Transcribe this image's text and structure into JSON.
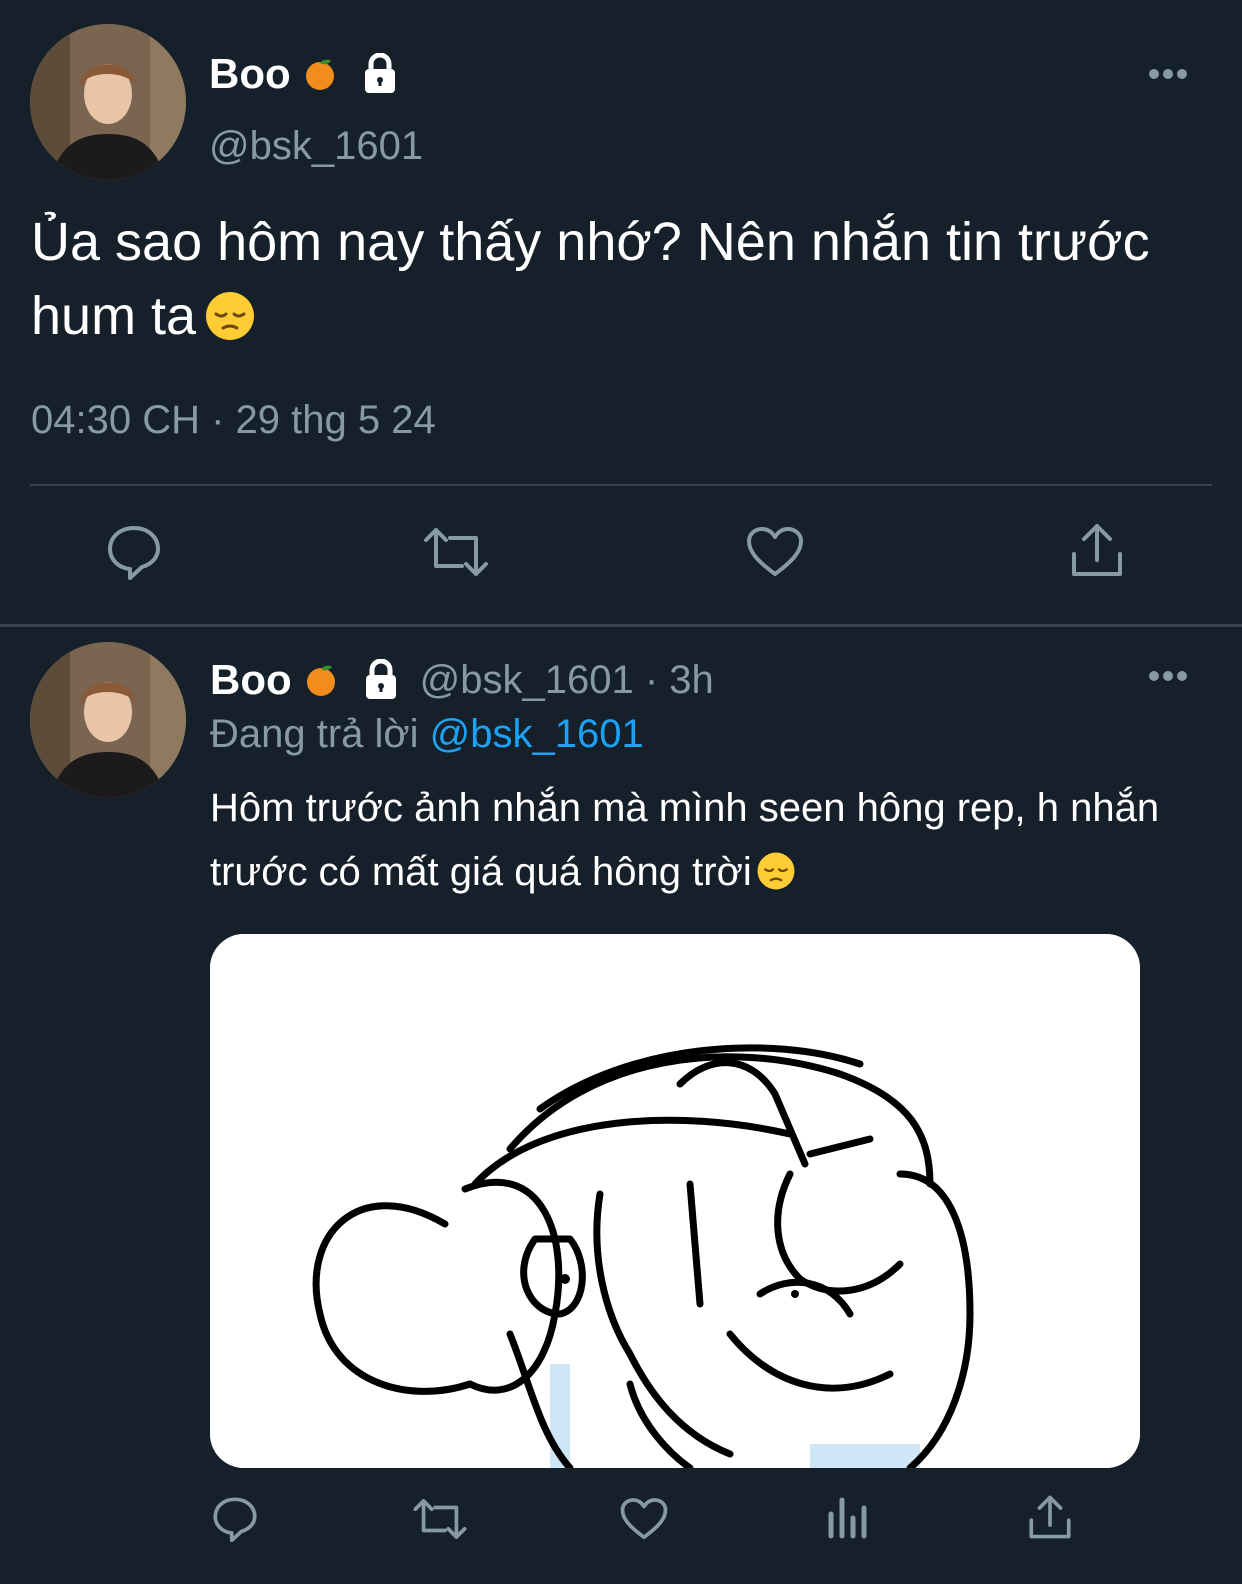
{
  "main_tweet": {
    "display_name": "Boo",
    "handle": "@bsk_1601",
    "text": "Ủa sao hôm nay thấy nhớ? Nên nhắn tin trước hum ta",
    "timestamp": "04:30 CH · 29 thg 5 24",
    "actions": [
      "reply-icon",
      "retweet-icon",
      "like-icon",
      "share-icon"
    ]
  },
  "reply_tweet": {
    "display_name": "Boo",
    "handle_time": "@bsk_1601 · 3h",
    "replying_prefix": "Đang trả lời",
    "replying_mention": "@bsk_1601",
    "text": "Hôm trước ảnh nhắn mà mình seen hông rep, h nhắn trước có mất giá quá hông trời",
    "actions": [
      "reply-icon",
      "retweet-icon",
      "like-icon",
      "analytics-icon",
      "share-icon"
    ]
  },
  "colors": {
    "background": "#15202b",
    "secondary_text": "#8899a6",
    "link": "#1da1f2",
    "divider": "#38444d"
  }
}
